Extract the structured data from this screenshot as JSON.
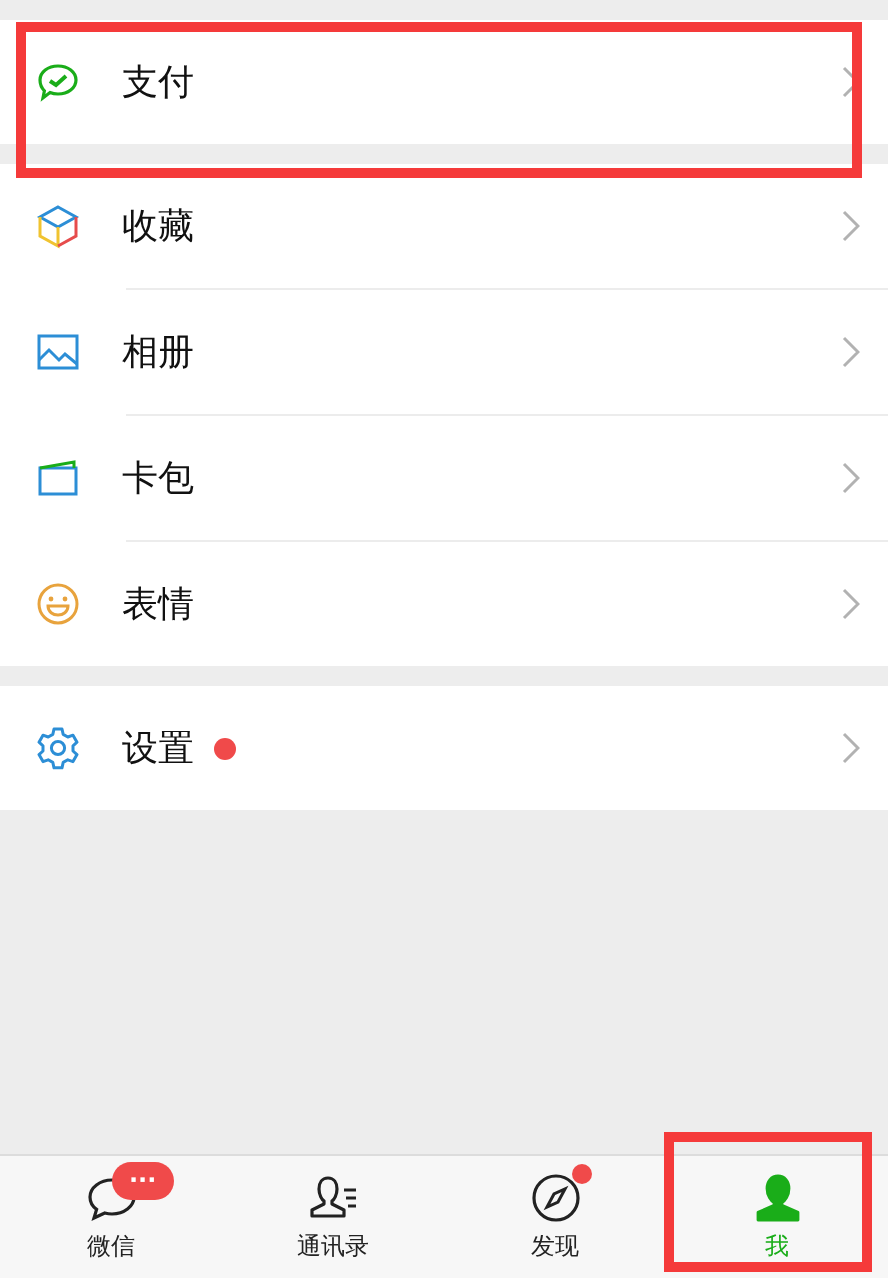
{
  "groups": [
    {
      "items": [
        {
          "kind": "pay",
          "label": "支付",
          "dot": false,
          "highlighted": true
        }
      ]
    },
    {
      "items": [
        {
          "kind": "favorites",
          "label": "收藏",
          "dot": false,
          "highlighted": false
        },
        {
          "kind": "album",
          "label": "相册",
          "dot": false,
          "highlighted": false
        },
        {
          "kind": "cards",
          "label": "卡包",
          "dot": false,
          "highlighted": false
        },
        {
          "kind": "stickers",
          "label": "表情",
          "dot": false,
          "highlighted": false
        }
      ]
    },
    {
      "items": [
        {
          "kind": "settings",
          "label": "设置",
          "dot": true,
          "highlighted": false
        }
      ]
    }
  ],
  "tab_bar": [
    {
      "kind": "chats",
      "label": "微信",
      "badge": "···",
      "dot": false,
      "selected": false,
      "highlighted": false
    },
    {
      "kind": "contacts",
      "label": "通讯录",
      "dot": false,
      "selected": false,
      "highlighted": false
    },
    {
      "kind": "discover",
      "label": "发现",
      "dot": true,
      "selected": false,
      "highlighted": false
    },
    {
      "kind": "me",
      "label": "我",
      "dot": false,
      "selected": true,
      "highlighted": true
    }
  ]
}
